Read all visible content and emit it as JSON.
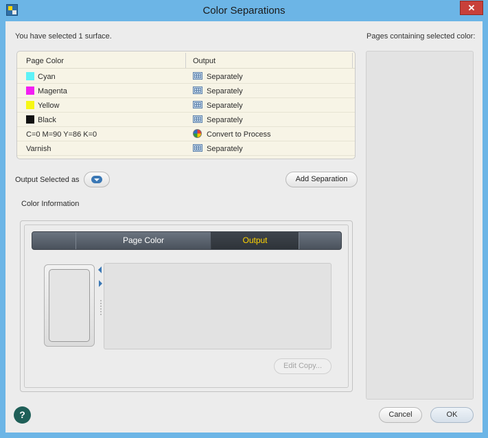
{
  "window": {
    "title": "Color Separations",
    "close_label": "✕"
  },
  "selection_text": "You have selected 1 surface.",
  "pages_label": "Pages containing selected color:",
  "table": {
    "headers": {
      "page_color": "Page Color",
      "output": "Output"
    },
    "rows": [
      {
        "name": "Cyan",
        "swatch": "#5ef2f7",
        "output": "Separately",
        "output_icon": "grid-icon"
      },
      {
        "name": "Magenta",
        "swatch": "#f21ef2",
        "output": "Separately",
        "output_icon": "grid-icon"
      },
      {
        "name": "Yellow",
        "swatch": "#f7f714",
        "output": "Separately",
        "output_icon": "grid-icon"
      },
      {
        "name": "Black",
        "swatch": "#111111",
        "output": "Separately",
        "output_icon": "grid-icon"
      },
      {
        "name": "C=0 M=90 Y=86 K=0",
        "swatch": "",
        "output": "Convert to Process",
        "output_icon": "process-icon"
      },
      {
        "name": "Varnish",
        "swatch": "",
        "output": "Separately",
        "output_icon": "grid-icon"
      }
    ]
  },
  "controls": {
    "output_selected_label": "Output Selected as",
    "add_separation_label": "Add Separation"
  },
  "color_info": {
    "label": "Color Information",
    "tabs": {
      "page_color": "Page Color",
      "output": "Output"
    },
    "edit_copy_label": "Edit Copy..."
  },
  "footer": {
    "help_label": "?",
    "cancel_label": "Cancel",
    "ok_label": "OK"
  }
}
